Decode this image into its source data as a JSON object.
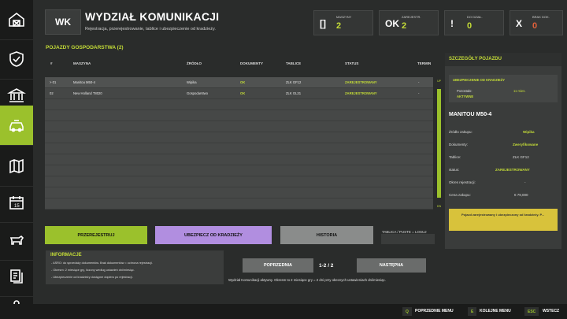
{
  "header": {
    "badge": "WK",
    "title": "WYDZIAŁ KOMUNIKACJI",
    "subtitle": "Rejestracja, przerejestrowanie, tablice i ubezpieczenie od kradzieży."
  },
  "stats": [
    {
      "symbol": "[]",
      "label": "MASZYNY",
      "value": "2",
      "color": "#c4dc37"
    },
    {
      "symbol": "OK",
      "label": "ZAREJESTR.",
      "value": "2",
      "color": "#c4dc37"
    },
    {
      "symbol": "!",
      "label": "DO DZIAŁ.",
      "value": "0",
      "color": "#c4dc37"
    },
    {
      "symbol": "X",
      "label": "BRAK DOK.",
      "value": "0",
      "color": "#e0603a"
    }
  ],
  "table": {
    "title": "POJAZDY GOSPODARSTWA (2)",
    "headers": [
      "#",
      "MASZYNA",
      "ŹRÓDŁO",
      "DOKUMENTY",
      "TABLICE",
      "STATUS",
      "TERMIN"
    ],
    "rows": [
      {
        "num": "> 01",
        "name": "Manitou M50-4",
        "source": "Wipika",
        "docs": "OK",
        "plates": "ZLK GF12",
        "status": "ZAREJESTROWANY",
        "term": "-"
      },
      {
        "num": "02",
        "name": "New Holland T8020",
        "source": "Gospodarstwo",
        "docs": "OK",
        "plates": "ZLK GL31",
        "status": "ZAREJESTROWANY",
        "term": "-"
      }
    ],
    "scroll_top": "UP",
    "scroll_bottom": "DN"
  },
  "buttons": {
    "register": "PRZEREJESTRUJ",
    "insure": "UBEZPIECZ OD KRADZIEŻY",
    "history": "HISTORIA",
    "plates_hint": "TABLICA / PUSTE = LOSUJ",
    "prev": "POPRZEDNIA",
    "next": "NASTĘPNA",
    "page": "1-2 / 2"
  },
  "info": {
    "title": "INFORMACJE",
    "lines": [
      "- ASRO: do sprzedaży dokumentów. Brak dokumentów = ochrona rejestracji.",
      "- Okresm: 2 miesiące gry, liczony według ustawień dni/miesiąc.",
      "- Ubezpieczenie od kradzieży dostępne dopiero po rejestracji."
    ]
  },
  "status_line": "Wydział Komunikacji aktywny. Okresm to 2 miesiące gry = 2 dni przy obecnych ustawieniach dni/miesiąc.",
  "detail": {
    "title": "SZCZEGÓŁY POJAZDU",
    "alert_title": "UBEZPIECZENIE OD KRADZIEŻY",
    "remaining_label": "Pozostało:",
    "remaining_value": "11 mies.",
    "alert_status": "AKTYWNE",
    "vehicle_name": "MANITOU M50-4",
    "fields": [
      {
        "key": "Źródło zakupu:",
        "value": "Wipika",
        "green": true
      },
      {
        "key": "Dokumenty:",
        "value": "Zweryfikowane",
        "green": true
      },
      {
        "key": "Tablice:",
        "value": "ZLK GF12",
        "green": false
      },
      {
        "key": "status:",
        "value": "ZAREJESTROWANY",
        "green": true
      },
      {
        "key": "Okres rejestracji:",
        "value": "-",
        "green": false
      },
      {
        "key": "Cena zakupu:",
        "value": "€ 79,000",
        "green": false
      }
    ],
    "note": "Pojazd zarejestrowany i ubezpieczony od kradzieży. P..."
  },
  "footer": {
    "prev_key": "Q",
    "prev_label": "POPRZEDNIE MENU",
    "next_key": "E",
    "next_label": "KOLEJNE MENU",
    "back_key": "ESC",
    "back_label": "WSTECZ"
  },
  "sidebar": {
    "icons": [
      "farm-icon",
      "shield-check-icon",
      "bank-icon",
      "vehicle-icon",
      "map-icon",
      "calendar-icon",
      "livestock-icon",
      "documents-icon",
      "person-icon"
    ],
    "active_index": 3
  },
  "colors": {
    "accent": "#9bc12c",
    "accent_text": "#c4dc37",
    "purple": "#b18ee0",
    "gray": "#8a8c8b",
    "note": "#d8c23b",
    "danger": "#e0603a"
  }
}
